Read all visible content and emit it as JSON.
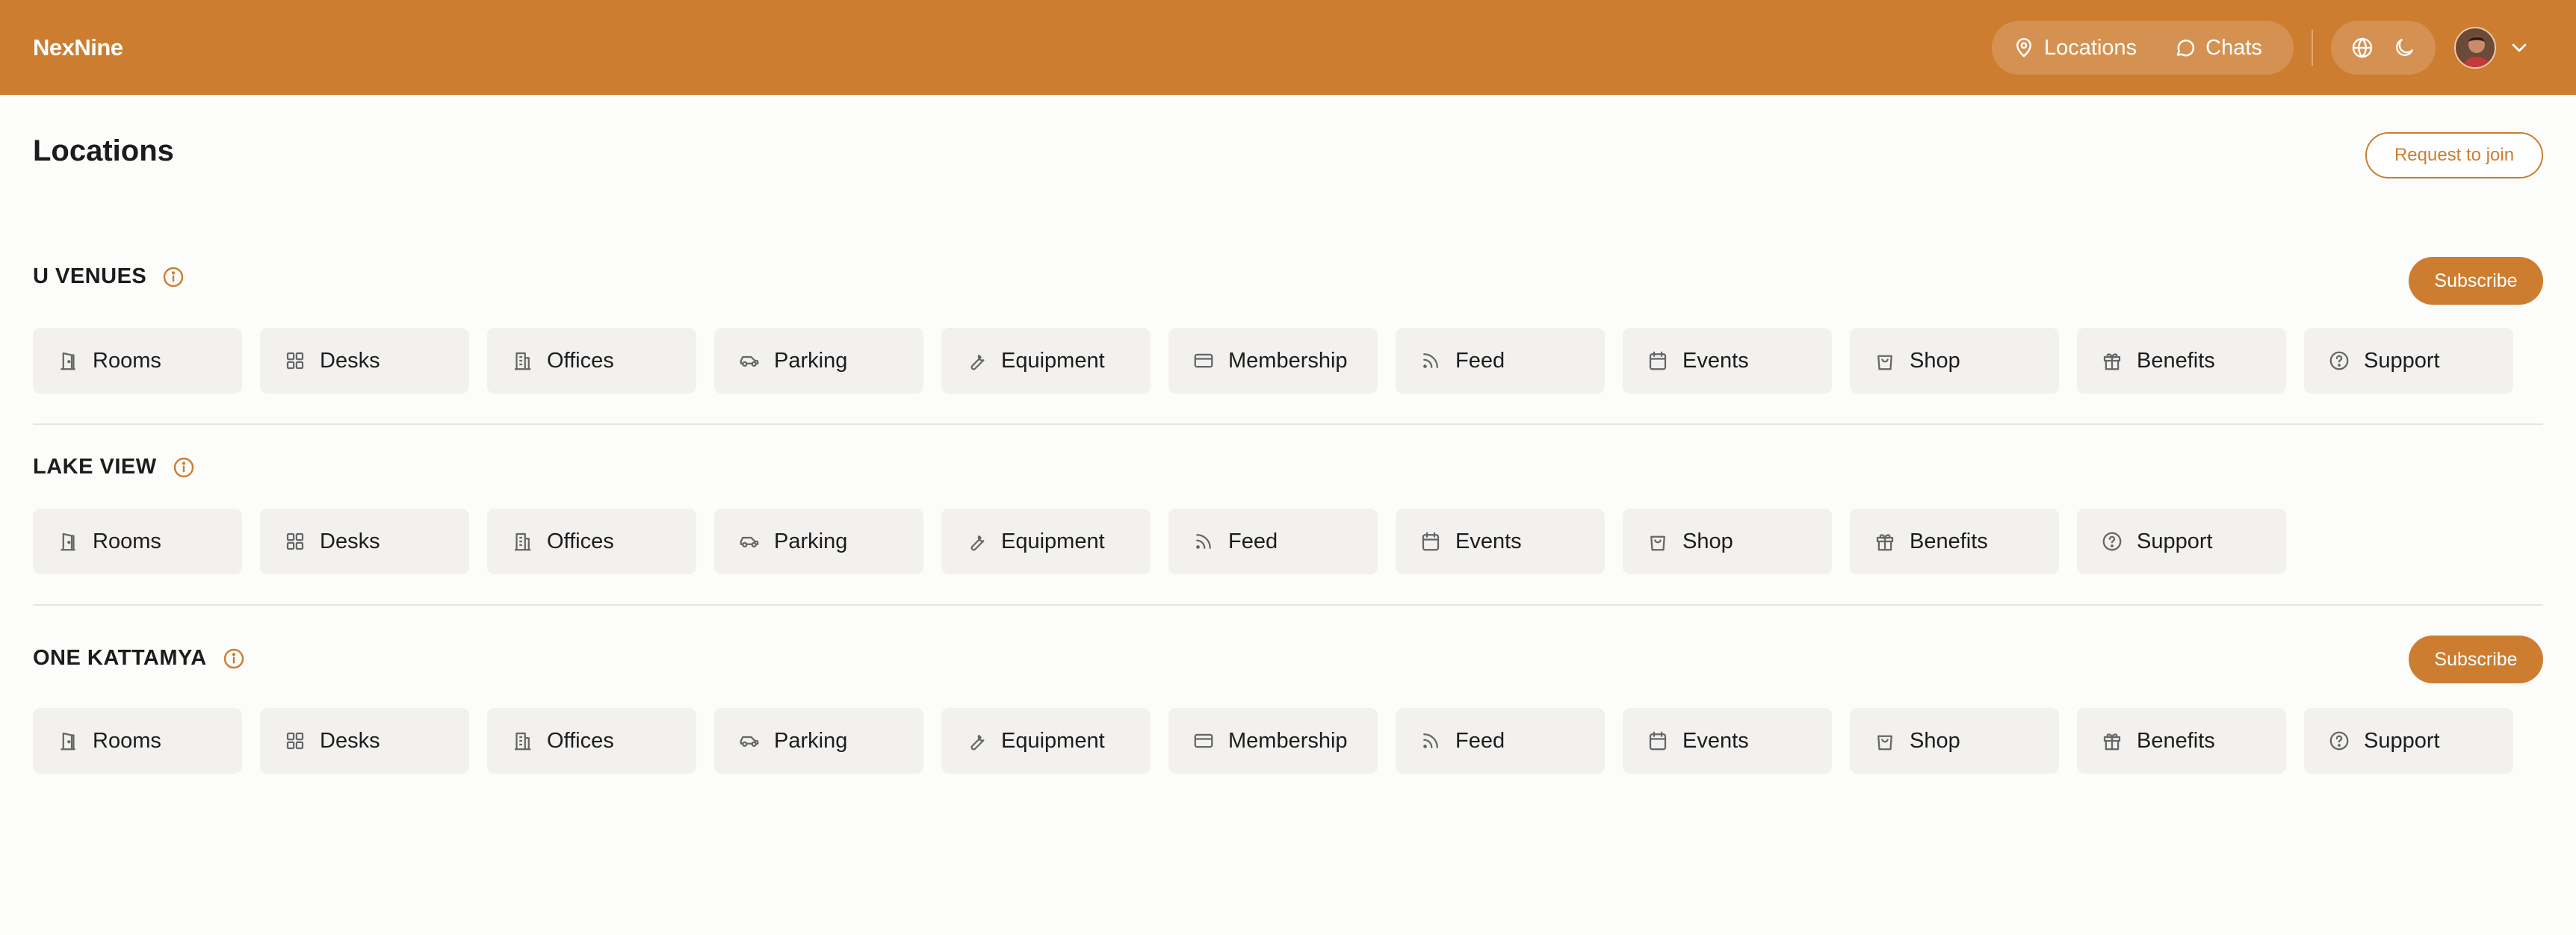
{
  "header": {
    "brand": "NexNine",
    "nav": [
      {
        "label": "Locations",
        "icon": "map-pin-icon"
      },
      {
        "label": "Chats",
        "icon": "chat-bubble-icon"
      }
    ],
    "utilities": [
      "globe-icon",
      "moon-icon"
    ],
    "avatar": "user-avatar",
    "menu_icon": "chevron-down-icon"
  },
  "page": {
    "title": "Locations",
    "request_button": "Request to join"
  },
  "sections": [
    {
      "title": "U VENUES",
      "subscribe": "Subscribe",
      "tiles": [
        "Rooms",
        "Desks",
        "Offices",
        "Parking",
        "Equipment",
        "Membership",
        "Feed",
        "Events",
        "Shop",
        "Benefits",
        "Support"
      ]
    },
    {
      "title": "LAKE VIEW",
      "tiles": [
        "Rooms",
        "Desks",
        "Offices",
        "Parking",
        "Equipment",
        "Feed",
        "Events",
        "Shop",
        "Benefits",
        "Support"
      ]
    },
    {
      "title": "ONE KATTAMYA",
      "subscribe": "Subscribe",
      "tiles": [
        "Rooms",
        "Desks",
        "Offices",
        "Parking",
        "Equipment",
        "Membership",
        "Feed",
        "Events",
        "Shop",
        "Benefits",
        "Support"
      ]
    }
  ],
  "colors": {
    "accent": "#cd7d30",
    "background": "#fcfcfa",
    "tile": "#f2f1ef"
  }
}
